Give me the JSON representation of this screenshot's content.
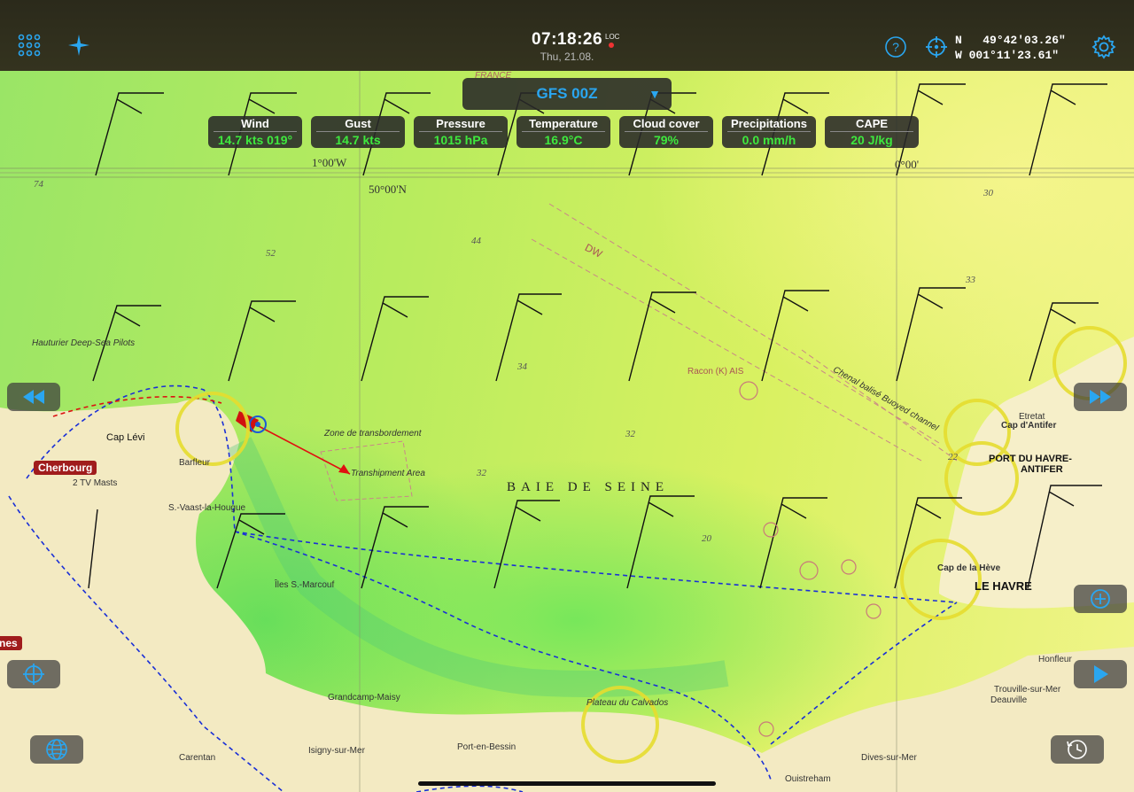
{
  "clock": {
    "time": "07:18:26",
    "loc_label": "LOC",
    "date": "Thu, 21.08."
  },
  "position": {
    "lat_hemi": "N",
    "lat": "49°42'03.26\"",
    "lon_hemi": "W",
    "lon": "001°11'23.61\""
  },
  "model": {
    "label": "GFS 00Z"
  },
  "weather": [
    {
      "label": "Wind",
      "value": "14.7 kts 019°"
    },
    {
      "label": "Gust",
      "value": "14.7 kts"
    },
    {
      "label": "Pressure",
      "value": "1015 hPa"
    },
    {
      "label": "Temperature",
      "value": "16.9°C"
    },
    {
      "label": "Cloud cover",
      "value": "79%"
    },
    {
      "label": "Precipitations",
      "value": "0.0 mm/h"
    },
    {
      "label": "CAPE",
      "value": "20 J/kg"
    }
  ],
  "tags": {
    "cherbourg": "Cherbourg",
    "left_cut": "nes"
  },
  "map_labels": {
    "baie": "BAIE    DE    SEINE",
    "le_havre": "LE HAVRE",
    "port": "PORT DU HAVRE-",
    "antifer": "ANTIFER",
    "etretat": "Etretat",
    "cap_antifer": "Cap d'Antifer",
    "cap_heve": "Cap de la Hève",
    "honfleur": "Honfleur",
    "deauville": "Deauville",
    "trouville": "Trouville-sur-Mer",
    "dives": "Dives-sur-Mer",
    "ouistreham": "Ouistreham",
    "port_bessin": "Port-en-Bessin",
    "isigny": "Isigny-sur-Mer",
    "carentan": "Carentan",
    "grandcamp": "Grandcamp-Maisy",
    "barfleur": "Barfleur",
    "cap_levi": "Cap Lévi",
    "st_vaast": "S.-Vaast-la-Hougue",
    "iles": "Îles S.-Marcouf",
    "plateau": "Plateau du Calvados",
    "zone": "Zone de transbordement",
    "transhipment": "Transhipment Area",
    "hauturier": "Hauturier Deep-Sea Pilots",
    "france": "FRANCE",
    "lat50": "50°00'N",
    "lon1": "1°00'W",
    "lon0": "0°00'",
    "chenal": "Chenal balisé Buoyed channel",
    "dw": "DW",
    "tv_masts": "2 TV Masts",
    "racon": "Racon (K) AIS"
  },
  "colors": {
    "accent": "#2aa6f0",
    "value": "#3ee83e",
    "tag": "#a01c1c"
  }
}
